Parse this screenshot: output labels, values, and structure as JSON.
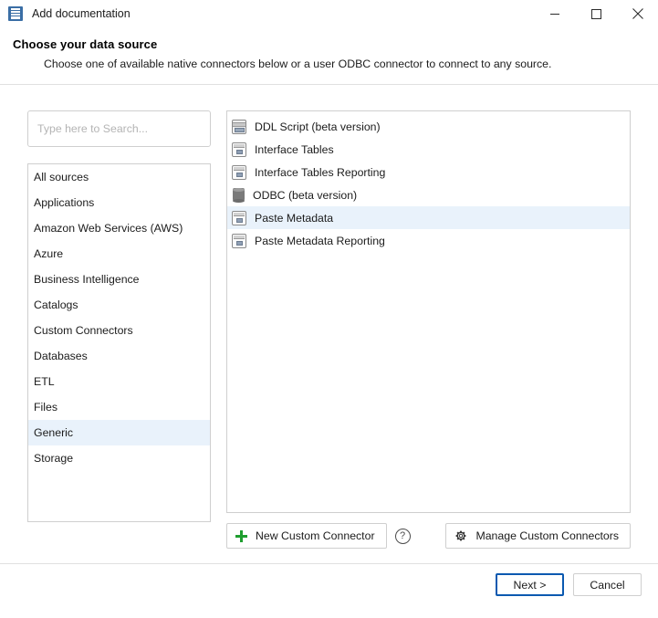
{
  "window": {
    "title": "Add documentation",
    "icon": "document-icon",
    "controls": {
      "minimize": "minimize-icon",
      "maximize": "maximize-icon",
      "close": "close-icon"
    }
  },
  "header": {
    "title": "Choose your data source",
    "subtitle": "Choose one of available native connectors below or a user ODBC connector to connect to any source."
  },
  "search": {
    "placeholder": "Type here to Search...",
    "value": ""
  },
  "categories": {
    "selected": "Generic",
    "items": [
      {
        "label": "All sources"
      },
      {
        "label": "Applications"
      },
      {
        "label": "Amazon Web Services (AWS)"
      },
      {
        "label": "Azure"
      },
      {
        "label": "Business Intelligence"
      },
      {
        "label": "Catalogs"
      },
      {
        "label": "Custom Connectors"
      },
      {
        "label": "Databases"
      },
      {
        "label": "ETL"
      },
      {
        "label": "Files"
      },
      {
        "label": "Generic"
      },
      {
        "label": "Storage"
      }
    ]
  },
  "connectors": {
    "selected": "Paste Metadata",
    "items": [
      {
        "label": "DDL Script (beta version)",
        "icon": "script-icon"
      },
      {
        "label": "Interface Tables",
        "icon": "table-icon"
      },
      {
        "label": "Interface Tables Reporting",
        "icon": "table-icon"
      },
      {
        "label": "ODBC (beta version)",
        "icon": "database-icon"
      },
      {
        "label": "Paste Metadata",
        "icon": "table-icon"
      },
      {
        "label": "Paste Metadata Reporting",
        "icon": "table-icon"
      }
    ]
  },
  "toolbar": {
    "new_custom_connector": "New Custom Connector",
    "help": "?",
    "manage_custom_connectors": "Manage Custom Connectors"
  },
  "footer": {
    "next": "Next >",
    "cancel": "Cancel"
  },
  "colors": {
    "accent": "#0a59b0",
    "selection": "#e9f2fb",
    "plus_green": "#1f9e2f",
    "title_icon_blue": "#3a6ea5"
  }
}
